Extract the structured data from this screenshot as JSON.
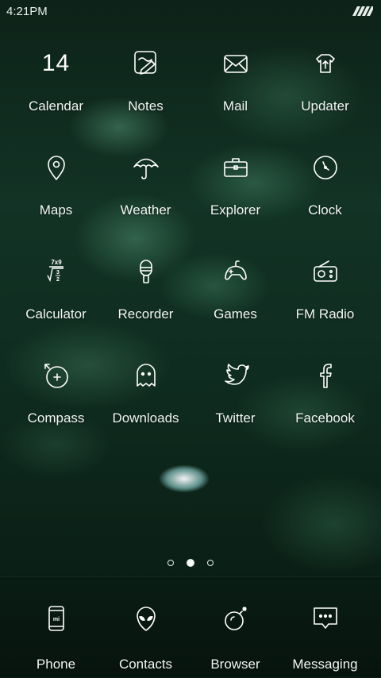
{
  "status": {
    "time": "4:21PM"
  },
  "calendar_day": "14",
  "apps": [
    [
      {
        "label": "Calendar",
        "icon": "calendar-icon"
      },
      {
        "label": "Notes",
        "icon": "notes-icon"
      },
      {
        "label": "Mail",
        "icon": "mail-icon"
      },
      {
        "label": "Updater",
        "icon": "updater-icon"
      }
    ],
    [
      {
        "label": "Maps",
        "icon": "map-pin-icon"
      },
      {
        "label": "Weather",
        "icon": "umbrella-icon"
      },
      {
        "label": "Explorer",
        "icon": "briefcase-icon"
      },
      {
        "label": "Clock",
        "icon": "clock-icon"
      }
    ],
    [
      {
        "label": "Calculator",
        "icon": "calculator-icon"
      },
      {
        "label": "Recorder",
        "icon": "recorder-icon"
      },
      {
        "label": "Games",
        "icon": "gamepad-icon"
      },
      {
        "label": "FM Radio",
        "icon": "radio-icon"
      }
    ],
    [
      {
        "label": "Compass",
        "icon": "compass-icon"
      },
      {
        "label": "Downloads",
        "icon": "ghost-icon"
      },
      {
        "label": "Twitter",
        "icon": "twitter-bird-icon"
      },
      {
        "label": "Facebook",
        "icon": "facebook-icon"
      }
    ]
  ],
  "dock": [
    {
      "label": "Phone",
      "icon": "phone-icon"
    },
    {
      "label": "Contacts",
      "icon": "alien-head-icon"
    },
    {
      "label": "Browser",
      "icon": "bomb-icon"
    },
    {
      "label": "Messaging",
      "icon": "message-bubble-icon"
    }
  ],
  "calculator_icon_text": {
    "top": "7x9",
    "num": "3",
    "den": "2"
  },
  "phone_icon_text": "mi",
  "page_indicator": {
    "pages": 3,
    "current": 2
  }
}
